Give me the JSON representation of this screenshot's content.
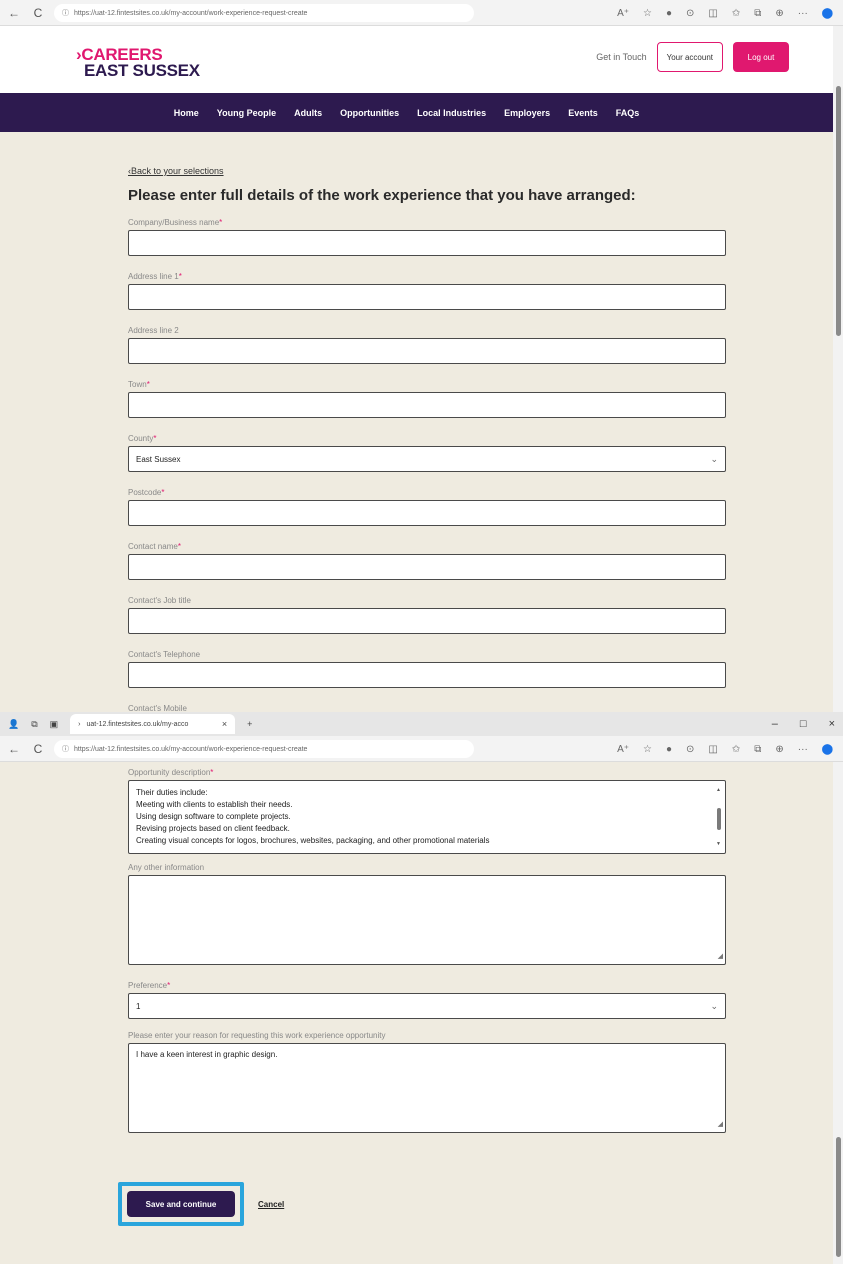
{
  "browser": {
    "url": "https://uat-12.fintestsites.co.uk/my-account/work-experience-request-create",
    "tab_title": "uat-12.fintestsites.co.uk/my-acco",
    "new_tab": "+",
    "nav_back": "←",
    "nav_reload": "C",
    "win_minimize": "–",
    "win_restore": "□",
    "win_close": "×"
  },
  "header": {
    "logo_line1": "CAREERS",
    "logo_chevron": "›",
    "logo_line2": "EAST SUSSEX",
    "get_in_touch": "Get in Touch",
    "your_account": "Your account",
    "log_out": "Log out"
  },
  "nav": {
    "items": [
      "Home",
      "Young People",
      "Adults",
      "Opportunities",
      "Local Industries",
      "Employers",
      "Events",
      "FAQs"
    ]
  },
  "form": {
    "back_link": "Back to your selections",
    "back_chevron": "‹",
    "heading": "Please enter full details of the work experience that you have arranged:",
    "fields": {
      "company": {
        "label": "Company/Business name",
        "required": "*",
        "value": ""
      },
      "address1": {
        "label": "Address line 1",
        "required": "*",
        "value": ""
      },
      "address2": {
        "label": "Address line 2",
        "value": ""
      },
      "town": {
        "label": "Town",
        "required": "*",
        "value": ""
      },
      "county": {
        "label": "County",
        "required": "*",
        "value": "East Sussex"
      },
      "postcode": {
        "label": "Postcode",
        "required": "*",
        "value": ""
      },
      "contact_name": {
        "label": "Contact name",
        "required": "*",
        "value": ""
      },
      "contact_job": {
        "label": "Contact's Job title",
        "value": ""
      },
      "contact_tel": {
        "label": "Contact's Telephone",
        "value": ""
      },
      "contact_mobile": {
        "label": "Contact's Mobile",
        "value": ""
      },
      "description": {
        "label": "Opportunity description",
        "required": "*",
        "lines": [
          "Their duties include:",
          "Meeting with clients to establish their needs.",
          "Using design software to complete projects.",
          "Revising projects based on client feedback.",
          "Creating visual concepts for logos, brochures, websites, packaging, and other promotional materials"
        ]
      },
      "other_info": {
        "label": "Any other information",
        "value": ""
      },
      "preference": {
        "label": "Preference",
        "required": "*",
        "value": "1"
      },
      "reason": {
        "label": "Please enter your reason for requesting this work experience opportunity",
        "value": "I have a keen interest in graphic design."
      }
    },
    "save_button": "Save and continue",
    "cancel_link": "Cancel"
  },
  "icons": {
    "chevron_down": "⌄",
    "lock": "ⓘ",
    "browser_toolbar": [
      "A⁺",
      "☆",
      "●",
      "⊙",
      "◫",
      "✩",
      "⧉",
      "⊕",
      "···",
      "⬤"
    ]
  },
  "colors": {
    "brand_pink": "#e0186f",
    "brand_purple": "#2d1a4f",
    "page_bg": "#efebe0",
    "highlight": "#2aa5dc"
  }
}
